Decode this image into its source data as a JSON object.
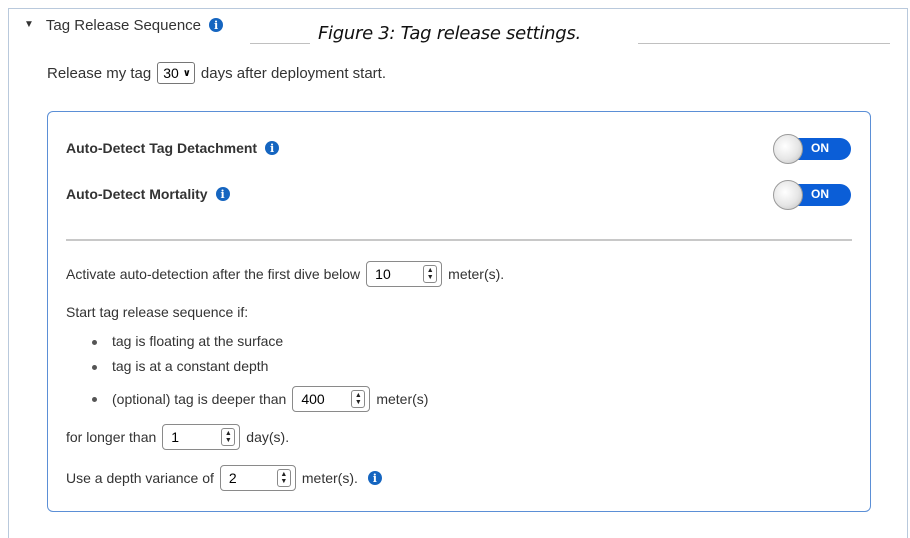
{
  "section": {
    "title": "Tag Release Sequence",
    "caption": "Figure 3: Tag release settings."
  },
  "release": {
    "prefix": "Release my tag",
    "days_value": "30",
    "suffix": "days after deployment start."
  },
  "toggles": {
    "detachment": {
      "label": "Auto-Detect Tag Detachment",
      "state": "ON"
    },
    "mortality": {
      "label": "Auto-Detect Mortality",
      "state": "ON"
    }
  },
  "activation": {
    "prefix": "Activate auto-detection after the first dive below",
    "value": "10",
    "unit": "meter(s)."
  },
  "sequence": {
    "intro": "Start tag release sequence if:",
    "bullet_1": "tag is floating at the surface",
    "bullet_2": "tag is at a constant depth",
    "bullet_3_prefix": "(optional) tag is deeper than",
    "bullet_3_value": "400",
    "bullet_3_unit": "meter(s)"
  },
  "duration": {
    "prefix": "for longer than",
    "value": "1",
    "unit": "day(s)."
  },
  "variance": {
    "prefix": "Use a depth variance of",
    "value": "2",
    "unit": "meter(s)."
  },
  "colors": {
    "accent": "#0b5ed7",
    "card_border": "#5b8fd6",
    "info_icon": "#1565c0"
  }
}
